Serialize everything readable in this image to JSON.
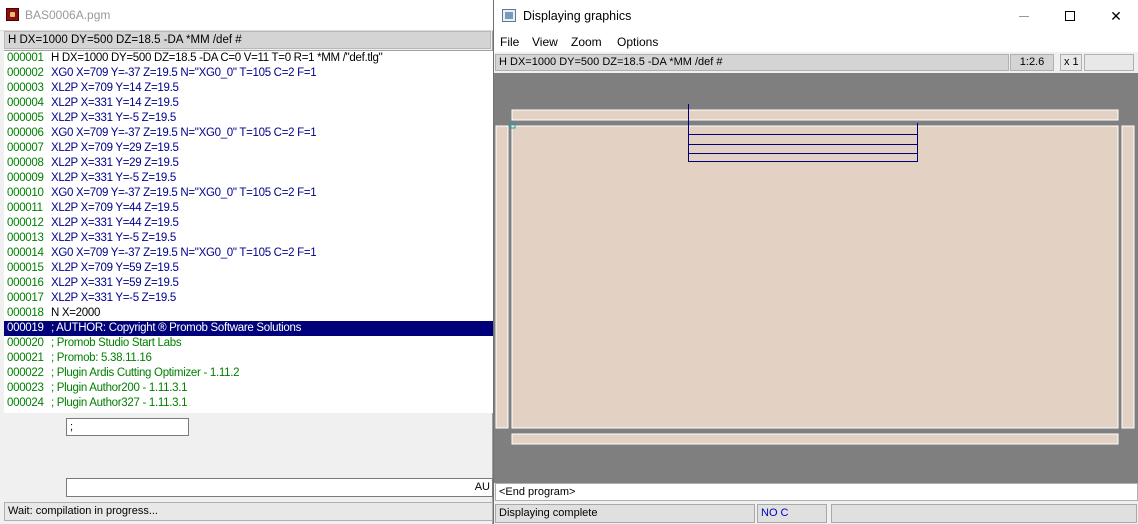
{
  "left_window": {
    "title": "BAS0006A.pgm",
    "header_text": "H DX=1000 DY=500 DZ=18.5 -DA *MM /def #",
    "lines": [
      {
        "num": "000001",
        "text": "H DX=1000 DY=500 DZ=18.5 -DA C=0 V=11 T=0 R=1 *MM /\"def.tlg\"",
        "color": "black"
      },
      {
        "num": "000002",
        "text": "XG0 X=709 Y=-37 Z=19.5 N=\"XG0_0\" T=105 C=2 F=1",
        "color": "blue"
      },
      {
        "num": "000003",
        "text": "XL2P X=709 Y=14 Z=19.5",
        "color": "blue"
      },
      {
        "num": "000004",
        "text": "XL2P X=331 Y=14 Z=19.5",
        "color": "blue"
      },
      {
        "num": "000005",
        "text": "XL2P X=331 Y=-5 Z=19.5",
        "color": "blue"
      },
      {
        "num": "000006",
        "text": "XG0 X=709 Y=-37 Z=19.5 N=\"XG0_0\" T=105 C=2 F=1",
        "color": "blue"
      },
      {
        "num": "000007",
        "text": "XL2P X=709 Y=29 Z=19.5",
        "color": "blue"
      },
      {
        "num": "000008",
        "text": "XL2P X=331 Y=29 Z=19.5",
        "color": "blue"
      },
      {
        "num": "000009",
        "text": "XL2P X=331 Y=-5 Z=19.5",
        "color": "blue"
      },
      {
        "num": "000010",
        "text": "XG0 X=709 Y=-37 Z=19.5 N=\"XG0_0\" T=105 C=2 F=1",
        "color": "blue"
      },
      {
        "num": "000011",
        "text": "XL2P X=709 Y=44 Z=19.5",
        "color": "blue"
      },
      {
        "num": "000012",
        "text": "XL2P X=331 Y=44 Z=19.5",
        "color": "blue"
      },
      {
        "num": "000013",
        "text": "XL2P X=331 Y=-5 Z=19.5",
        "color": "blue"
      },
      {
        "num": "000014",
        "text": "XG0 X=709 Y=-37 Z=19.5 N=\"XG0_0\" T=105 C=2 F=1",
        "color": "blue"
      },
      {
        "num": "000015",
        "text": "XL2P X=709 Y=59 Z=19.5",
        "color": "blue"
      },
      {
        "num": "000016",
        "text": "XL2P X=331 Y=59 Z=19.5",
        "color": "blue"
      },
      {
        "num": "000017",
        "text": "XL2P X=331 Y=-5 Z=19.5",
        "color": "blue"
      },
      {
        "num": "000018",
        "text": "N X=2000",
        "color": "black"
      },
      {
        "num": "000019",
        "text": "; AUTHOR: Copyright ® Promob Software Solutions",
        "color": "green",
        "selected": true
      },
      {
        "num": "000020",
        "text": "; Promob Studio Start Labs",
        "color": "green"
      },
      {
        "num": "000021",
        "text": "; Promob: 5.38.11.16",
        "color": "green"
      },
      {
        "num": "000022",
        "text": "; Plugin Ardis Cutting Optimizer - 1.11.2",
        "color": "green"
      },
      {
        "num": "000023",
        "text": "; Plugin Author200 - 1.11.3.1",
        "color": "green"
      },
      {
        "num": "000024",
        "text": "; Plugin Author327 - 1.11.3.1",
        "color": "green"
      }
    ],
    "small_input_value": ";",
    "wide_input_suffix": "AU",
    "status": "Wait: compilation in progress..."
  },
  "right_window": {
    "title": "Displaying graphics",
    "icons": {
      "app": "window-app-icon",
      "minimize": "minimize-icon",
      "maximize": "maximize-icon",
      "close": "close-icon"
    },
    "close_glyph": "✕",
    "menu": {
      "file": "File",
      "view": "View",
      "zoom": "Zoom",
      "options": "Options"
    },
    "header_text": "H DX=1000 DY=500 DZ=18.5 -DA *MM /def #",
    "scale": "1:2.6",
    "zoom_level": "x 1",
    "end_program": "<End program>",
    "status": "Displaying complete",
    "status_mode": "NO C",
    "colors": {
      "panel": "#e3d2c4",
      "canvas": "#7f7f7f",
      "toolpath": "#00007b"
    }
  }
}
